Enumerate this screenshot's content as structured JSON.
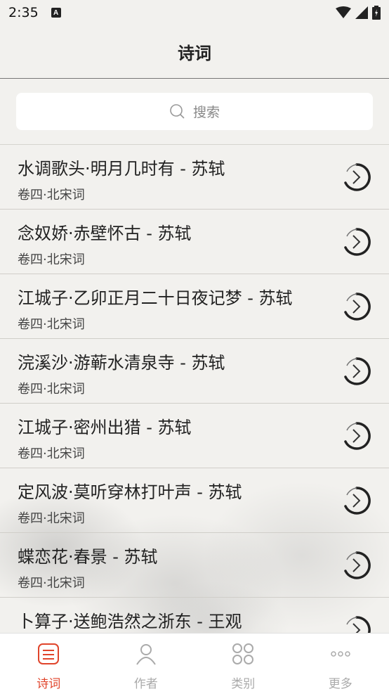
{
  "status": {
    "time": "2:35"
  },
  "header": {
    "title": "诗词"
  },
  "search": {
    "placeholder": "搜索"
  },
  "poems": [
    {
      "title": "水调歌头·明月几时有 - 苏轼",
      "subtitle": "卷四·北宋词"
    },
    {
      "title": "念奴娇·赤壁怀古 - 苏轼",
      "subtitle": "卷四·北宋词"
    },
    {
      "title": "江城子·乙卯正月二十日夜记梦 - 苏轼",
      "subtitle": "卷四·北宋词"
    },
    {
      "title": "浣溪沙·游蕲水清泉寺 - 苏轼",
      "subtitle": "卷四·北宋词"
    },
    {
      "title": "江城子·密州出猎 - 苏轼",
      "subtitle": "卷四·北宋词"
    },
    {
      "title": "定风波·莫听穿林打叶声 - 苏轼",
      "subtitle": "卷四·北宋词"
    },
    {
      "title": "蝶恋花·春景 - 苏轼",
      "subtitle": "卷四·北宋词"
    },
    {
      "title": "卜算子·送鲍浩然之浙东 - 王观",
      "subtitle": ""
    }
  ],
  "tabs": [
    {
      "label": "诗词",
      "icon": "poem-icon",
      "active": true
    },
    {
      "label": "作者",
      "icon": "person-icon",
      "active": false
    },
    {
      "label": "类别",
      "icon": "grid-icon",
      "active": false
    },
    {
      "label": "更多",
      "icon": "more-icon",
      "active": false
    }
  ],
  "colors": {
    "accent": "#e0442b",
    "inactive": "#aaaaaa"
  }
}
